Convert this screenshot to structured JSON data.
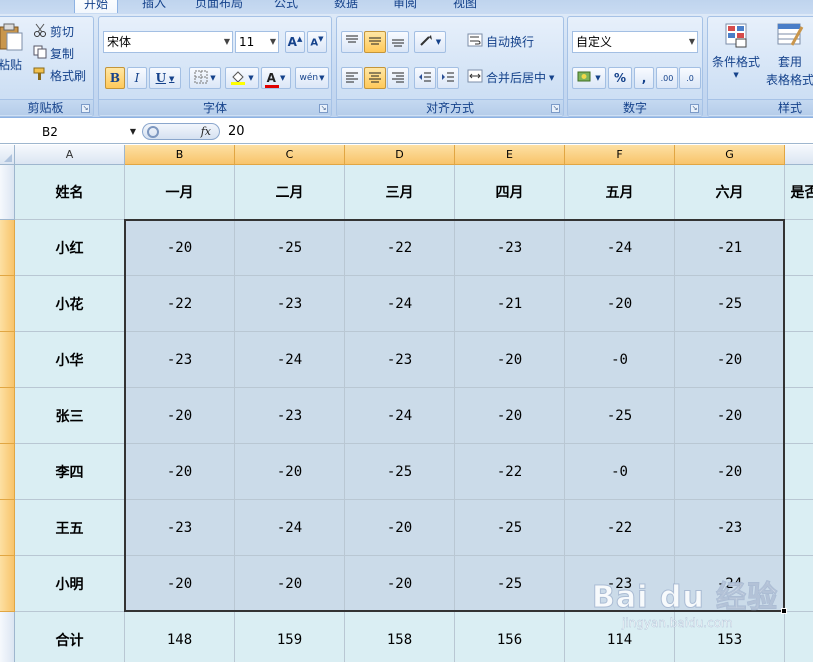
{
  "tabs": [
    {
      "label": "开始",
      "active": true
    },
    {
      "label": "插入",
      "active": false
    },
    {
      "label": "页面布局",
      "active": false
    },
    {
      "label": "公式",
      "active": false
    },
    {
      "label": "数据",
      "active": false
    },
    {
      "label": "审阅",
      "active": false
    },
    {
      "label": "视图",
      "active": false
    }
  ],
  "ribbon": {
    "clipboard": {
      "label": "剪贴板",
      "paste": "粘贴",
      "cut": "剪切",
      "copy": "复制",
      "format_painter": "格式刷"
    },
    "font": {
      "label": "字体",
      "font_name": "宋体",
      "font_size": "11",
      "bold": "B",
      "italic": "I",
      "underline": "U",
      "font_color_letter": "A",
      "phonetic": "wén"
    },
    "alignment": {
      "label": "对齐方式",
      "wrap_text": "自动换行",
      "merge_center": "合并后居中"
    },
    "number": {
      "label": "数字",
      "format": "自定义",
      "percent": "%",
      "comma": ",",
      "inc_decimal": ".00",
      "dec_decimal": ".0"
    },
    "styles": {
      "label": "样式",
      "conditional_format": "条件格式",
      "table_format_1": "套用",
      "table_format_2": "表格格式"
    }
  },
  "formula_bar": {
    "name_box": "B2",
    "fx": "fx",
    "value": "20"
  },
  "columns": [
    "A",
    "B",
    "C",
    "D",
    "E",
    "F",
    "G"
  ],
  "table": {
    "headers": [
      "姓名",
      "一月",
      "二月",
      "三月",
      "四月",
      "五月",
      "六月",
      "是否"
    ],
    "rows": [
      [
        "小红",
        "-20",
        "-25",
        "-22",
        "-23",
        "-24",
        "-21"
      ],
      [
        "小花",
        "-22",
        "-23",
        "-24",
        "-21",
        "-20",
        "-25"
      ],
      [
        "小华",
        "-23",
        "-24",
        "-23",
        "-20",
        "-0",
        "-20"
      ],
      [
        "张三",
        "-20",
        "-23",
        "-24",
        "-20",
        "-25",
        "-20"
      ],
      [
        "李四",
        "-20",
        "-20",
        "-25",
        "-22",
        "-0",
        "-20"
      ],
      [
        "王五",
        "-23",
        "-24",
        "-20",
        "-25",
        "-22",
        "-23"
      ],
      [
        "小明",
        "-20",
        "-20",
        "-20",
        "-25",
        "-23",
        "-24"
      ]
    ],
    "total": [
      "合计",
      "148",
      "159",
      "158",
      "156",
      "114",
      "153"
    ]
  },
  "watermark": {
    "logo": "Bai du 经验",
    "url": "jingyan.baidu.com"
  },
  "colors": {
    "cell_fill": "#daeef3",
    "selected_fill": "#cbdbe9",
    "selected_header": "#f8c46b"
  }
}
